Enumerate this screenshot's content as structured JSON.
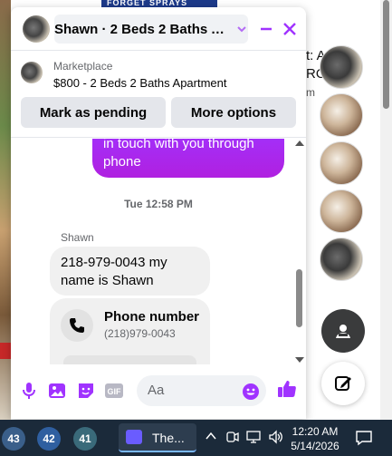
{
  "background": {
    "banner_text": "FORGET SPRAYS",
    "right_text_line1": "t: Ar",
    "right_text_line2": "RO",
    "right_text_line3": "m"
  },
  "chat": {
    "title": "Shawn · 2 Beds 2 Baths Ap...",
    "accent_color": "#a033ff",
    "marketplace": {
      "label": "Marketplace",
      "listing": "$800 - 2 Beds 2 Baths Apartment",
      "mark_pending_label": "Mark as pending",
      "more_options_label": "More options"
    },
    "messages": {
      "outgoing_text": "in touch with you through phone",
      "timestamp": "Tue 12:58 PM",
      "sender": "Shawn",
      "incoming_text": "218-979-0043 my name is Shawn",
      "phone_card_title": "Phone number",
      "phone_card_number": "(218)979-0043"
    },
    "composer": {
      "placeholder": "Aa"
    }
  },
  "taskbar": {
    "weather": [
      "43",
      "42",
      "41"
    ],
    "app_label": "The...",
    "clock_time": "12:20 AM",
    "clock_date": "5/14/2026"
  }
}
